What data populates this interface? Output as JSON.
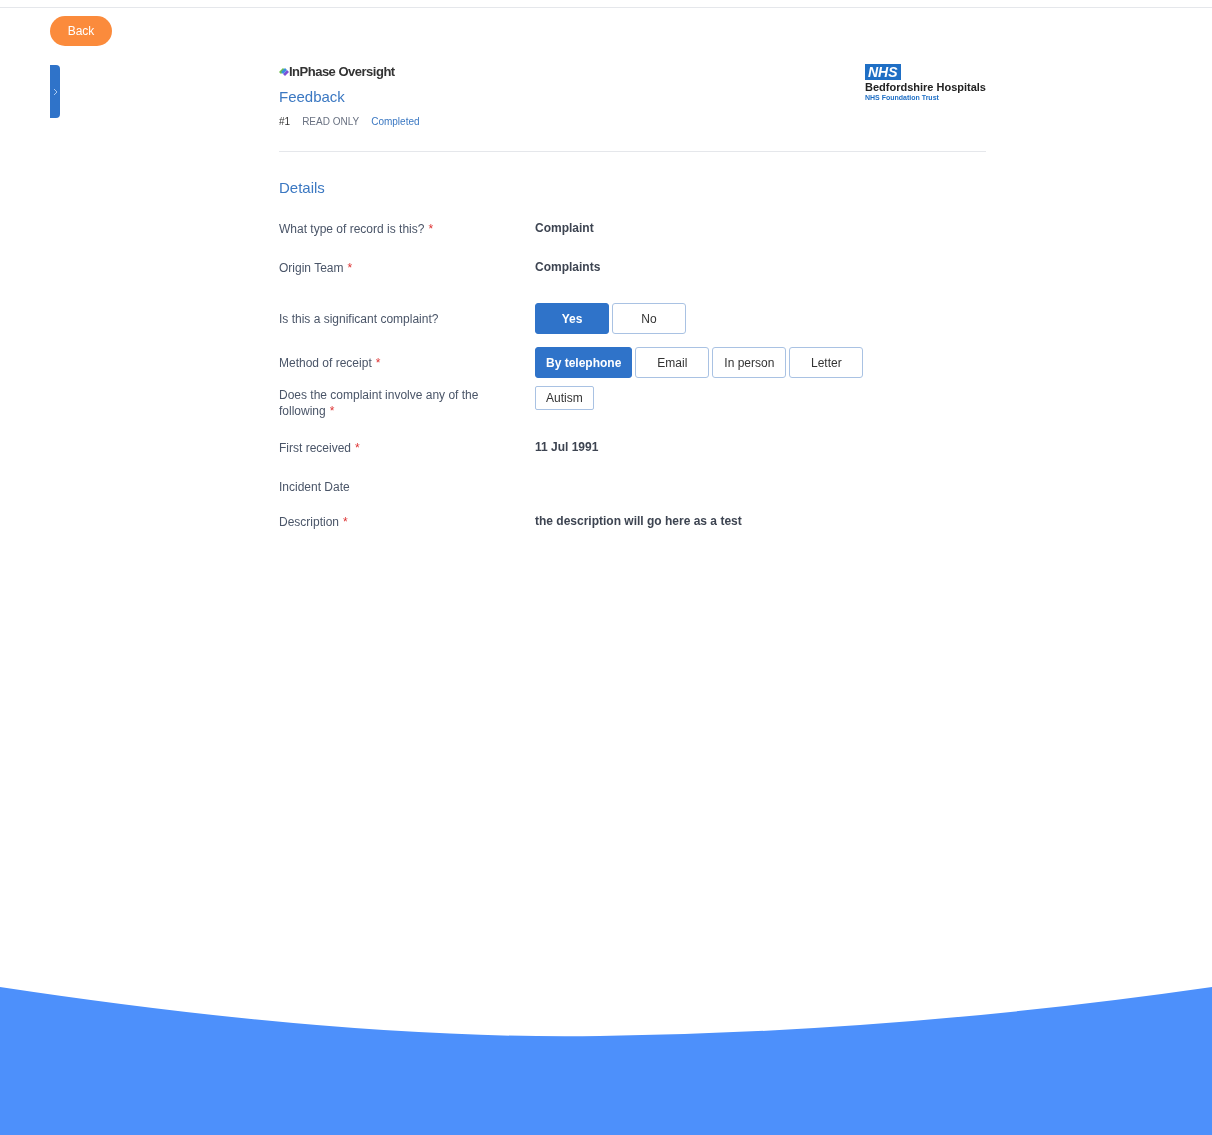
{
  "back_button": "Back",
  "header": {
    "product": "InPhase Oversight",
    "form_title": "Feedback",
    "record_number": "#1",
    "access": "READ ONLY",
    "status": "Completed"
  },
  "organisation": {
    "badge": "NHS",
    "name": "Bedfordshire Hospitals",
    "subtitle": "NHS Foundation Trust"
  },
  "section_title": "Details",
  "fields": [
    {
      "kind": "text",
      "label": "What type of record is this?",
      "required_mark": "*",
      "value": "Complaint"
    },
    {
      "kind": "text",
      "label": "Origin Team",
      "required_mark": "*",
      "value": "Complaints"
    },
    {
      "kind": "choice",
      "label": "Is this a significant complaint?",
      "options": [
        {
          "label": "Yes",
          "selected": true
        },
        {
          "label": "No",
          "selected": false
        }
      ]
    },
    {
      "kind": "choice",
      "label": "Method of receipt",
      "required_mark": "*",
      "options": [
        {
          "label": "By telephone",
          "selected": true
        },
        {
          "label": "Email",
          "selected": false
        },
        {
          "label": "In person",
          "selected": false
        },
        {
          "label": "Letter",
          "selected": false
        }
      ]
    },
    {
      "kind": "tags",
      "label": "Does the complaint involve any of the following",
      "required_mark": "*",
      "tags": [
        "Autism"
      ]
    },
    {
      "kind": "text",
      "label": "First received",
      "required_mark": "*",
      "value": "11 Jul 1991"
    },
    {
      "kind": "empty",
      "label": "Incident Date"
    },
    {
      "kind": "text",
      "label": "Description",
      "required_mark": "*",
      "value": "the description will go here as a test"
    }
  ]
}
